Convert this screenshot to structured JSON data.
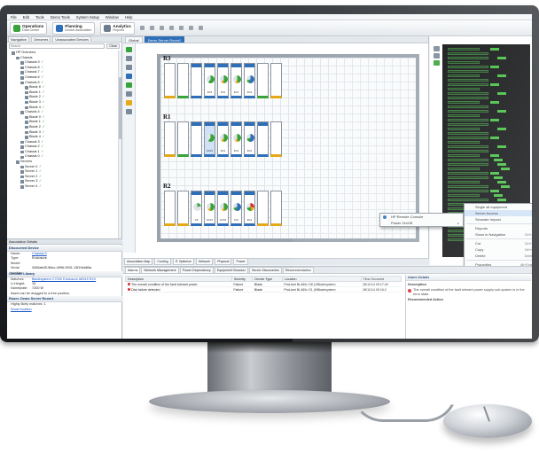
{
  "menu": [
    "File",
    "Edit",
    "Tools",
    "Demo Tools",
    "System Setup",
    "Window",
    "Help"
  ],
  "toolbar": {
    "operations": {
      "title": "Operations",
      "subtitle": "Data Center"
    },
    "planning": {
      "title": "Planning",
      "subtitle": "Device Association"
    },
    "analytics": {
      "title": "Analytics",
      "subtitle": "Reports"
    }
  },
  "left": {
    "tabs": [
      "Navigation",
      "Genomes",
      "Unassociated Devices"
    ],
    "search_placeholder": "Search",
    "clear_label": "Clear",
    "tree": [
      {
        "label": "HP Overview",
        "depth": 1
      },
      {
        "label": "Chassis",
        "depth": 2
      },
      {
        "label": "Chassis 9",
        "depth": 3
      },
      {
        "label": "Chassis 8",
        "depth": 3
      },
      {
        "label": "Chassis 7",
        "depth": 3
      },
      {
        "label": "Chassis 6",
        "depth": 3
      },
      {
        "label": "Chassis 5",
        "depth": 3
      },
      {
        "label": "Blade 8",
        "depth": 4
      },
      {
        "label": "Blade 1",
        "depth": 4
      },
      {
        "label": "Blade 2",
        "depth": 4
      },
      {
        "label": "Blade 3",
        "depth": 4
      },
      {
        "label": "Blade 4",
        "depth": 4
      },
      {
        "label": "Chassis 4",
        "depth": 3
      },
      {
        "label": "Blade 0",
        "depth": 4
      },
      {
        "label": "Blade 1",
        "depth": 4
      },
      {
        "label": "Blade 2",
        "depth": 4
      },
      {
        "label": "Blade 3",
        "depth": 4
      },
      {
        "label": "Blade 4",
        "depth": 4
      },
      {
        "label": "Chassis 3",
        "depth": 3
      },
      {
        "label": "Chassis 2",
        "depth": 3
      },
      {
        "label": "Chassis 1",
        "depth": 3
      },
      {
        "label": "Chassis 0",
        "depth": 3
      },
      {
        "label": "Servers",
        "depth": 2
      },
      {
        "label": "Server 0",
        "depth": 3
      },
      {
        "label": "Server 1",
        "depth": 3
      },
      {
        "label": "Server 2",
        "depth": 3
      },
      {
        "label": "Server 3",
        "depth": 3
      },
      {
        "label": "Server 4",
        "depth": 3
      }
    ],
    "details_header": "Association Details",
    "discovered": {
      "title": "Discovered Device",
      "rows": [
        {
          "k": "Name:",
          "v": "Chassis 8"
        },
        {
          "k": "Type:",
          "v": "Enclosure"
        },
        {
          "k": "Model:",
          "v": ""
        },
        {
          "k": "Serial number:",
          "v": "3456ab05-56ec-4996-9931-13f19eb89a"
        }
      ]
    },
    "genome": {
      "title": "Genome Library",
      "rows": [
        {
          "k": "Matches:",
          "v": "Bladesystem C7000 Enclosure A6315 R2X"
        },
        {
          "k": "U-Height:",
          "v": "10"
        },
        {
          "k": "Nameplate:",
          "v": "7200 W"
        }
      ],
      "note": "Asset can be dragged to a free position."
    },
    "room": {
      "title": "Room: Demo Server Room1",
      "note": "Highly likely matches: 1",
      "link": "Show location"
    }
  },
  "center": {
    "tabs": [
      "Global",
      "Demo Server Room1"
    ],
    "rows": [
      {
        "label": "R3",
        "racks": [
          {
            "color": "orange",
            "pie": null,
            "label": ""
          },
          {
            "color": "green",
            "pie": null,
            "label": ""
          },
          {
            "color": "blue",
            "pie": null,
            "label": ""
          },
          {
            "color": "blue",
            "pie": "a",
            "label": "9/15"
          },
          {
            "color": "blue",
            "pie": "b",
            "label": "9/11"
          },
          {
            "color": "blue",
            "pie": "c",
            "label": "9/12"
          },
          {
            "color": "blue",
            "pie": "d",
            "label": "9/12"
          },
          {
            "color": "green",
            "pie": null,
            "label": ""
          },
          {
            "color": "orange",
            "pie": null,
            "label": ""
          }
        ]
      },
      {
        "label": "R1",
        "racks": [
          {
            "color": "orange",
            "pie": null,
            "label": ""
          },
          {
            "color": "green",
            "pie": null,
            "label": ""
          },
          {
            "color": "blue",
            "pie": null,
            "label": ""
          },
          {
            "color": "blue",
            "pie": "a",
            "label": "10/15",
            "sel": true
          },
          {
            "color": "blue",
            "pie": "b",
            "label": "9/12"
          },
          {
            "color": "blue",
            "pie": "c",
            "label": "9/12"
          },
          {
            "color": "blue",
            "pie": "d",
            "label": "9/12"
          },
          {
            "color": "blue",
            "pie": null,
            "label": ""
          },
          {
            "color": "orange",
            "pie": null,
            "label": ""
          }
        ]
      },
      {
        "label": "R2",
        "racks": [
          {
            "color": "orange",
            "pie": null,
            "label": ""
          },
          {
            "color": "orange",
            "pie": null,
            "label": ""
          },
          {
            "color": "blue",
            "pie": "e",
            "label": "1/5"
          },
          {
            "color": "blue",
            "pie": "b",
            "label": "10/19"
          },
          {
            "color": "blue",
            "pie": "c",
            "label": "10/18"
          },
          {
            "color": "blue",
            "pie": "d",
            "label": "7/12"
          },
          {
            "color": "blue",
            "pie": "f",
            "label": "9/12"
          },
          {
            "color": "orange",
            "pie": null,
            "label": ""
          },
          {
            "color": "orange",
            "pie": null,
            "label": ""
          }
        ]
      }
    ],
    "view_tabs": [
      "Association Map",
      "Cooling",
      "IT Optimize",
      "Network",
      "Physical",
      "Power"
    ]
  },
  "context_menu": {
    "left": [
      {
        "label": "HP Remote Console",
        "icon": true
      },
      {
        "label": "Power On/Off",
        "submenu": true
      }
    ],
    "right": [
      {
        "label": "Single all equipment"
      },
      {
        "label": "Server Access",
        "submenu": true,
        "highlight": true
      },
      {
        "label": "Simulate Impact"
      },
      {
        "label": "Reports",
        "submenu": true
      },
      {
        "label": "Show in Navigation",
        "shortcut": "Ctrl+A"
      },
      {
        "label": "Cut",
        "shortcut": "Ctrl+X"
      },
      {
        "label": "Copy",
        "shortcut": "Ctrl+C"
      },
      {
        "label": "Delete",
        "shortcut": "Delete"
      },
      {
        "label": "Properties",
        "shortcut": "Alt+Enter"
      }
    ]
  },
  "bottom": {
    "tabs": [
      "Alarms",
      "Network Management",
      "Power Dependency",
      "Equipment Browser",
      "Server Discoveries",
      "Recommendation"
    ],
    "columns": [
      "Description",
      "Severity",
      "Device Type",
      "Location",
      "Time Occurred"
    ],
    "rows": [
      [
        "The overall condition of the fault tolerant power",
        "Failure",
        "Blade",
        "ProLiant BL460c G8 (1/Bladesystem",
        "28/11/14 09:17:00"
      ],
      [
        "Disk failure detected",
        "Failure",
        "Blade",
        "ProLiant BL460c G1 (9/Bladesystem",
        "28/11/14 09:16:2"
      ]
    ],
    "details": {
      "title": "Alarm Details",
      "description_label": "Description",
      "description": "The overall condition of the fault tolerant power supply sub-system is in the error state.",
      "recommended": "Recommended Action"
    }
  },
  "colors": {
    "orange": "#e6a817",
    "blue": "#2f6fb8",
    "green": "#38a33a",
    "critical": "#d62b2b"
  }
}
